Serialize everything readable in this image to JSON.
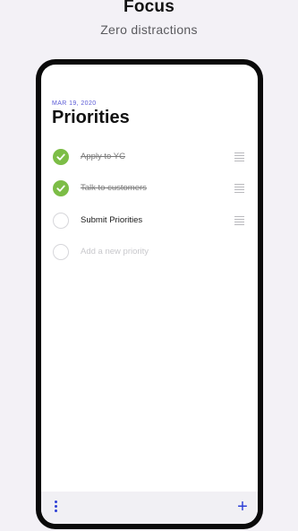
{
  "hero": {
    "title": "Focus",
    "subtitle": "Zero distractions"
  },
  "screen": {
    "date": "MAR 19, 2020",
    "title": "Priorities",
    "items": [
      {
        "label": "Apply to YC",
        "completed": true
      },
      {
        "label": "Talk to customers",
        "completed": true
      },
      {
        "label": "Submit Priorities",
        "completed": false
      }
    ],
    "new_item_placeholder": "Add a new priority"
  },
  "bottom_bar": {
    "menu_icon": "more-vertical-icon",
    "add_label": "+"
  },
  "colors": {
    "accent": "#2d3fd6",
    "done": "#7cbd46",
    "date": "#5b5bd6"
  }
}
